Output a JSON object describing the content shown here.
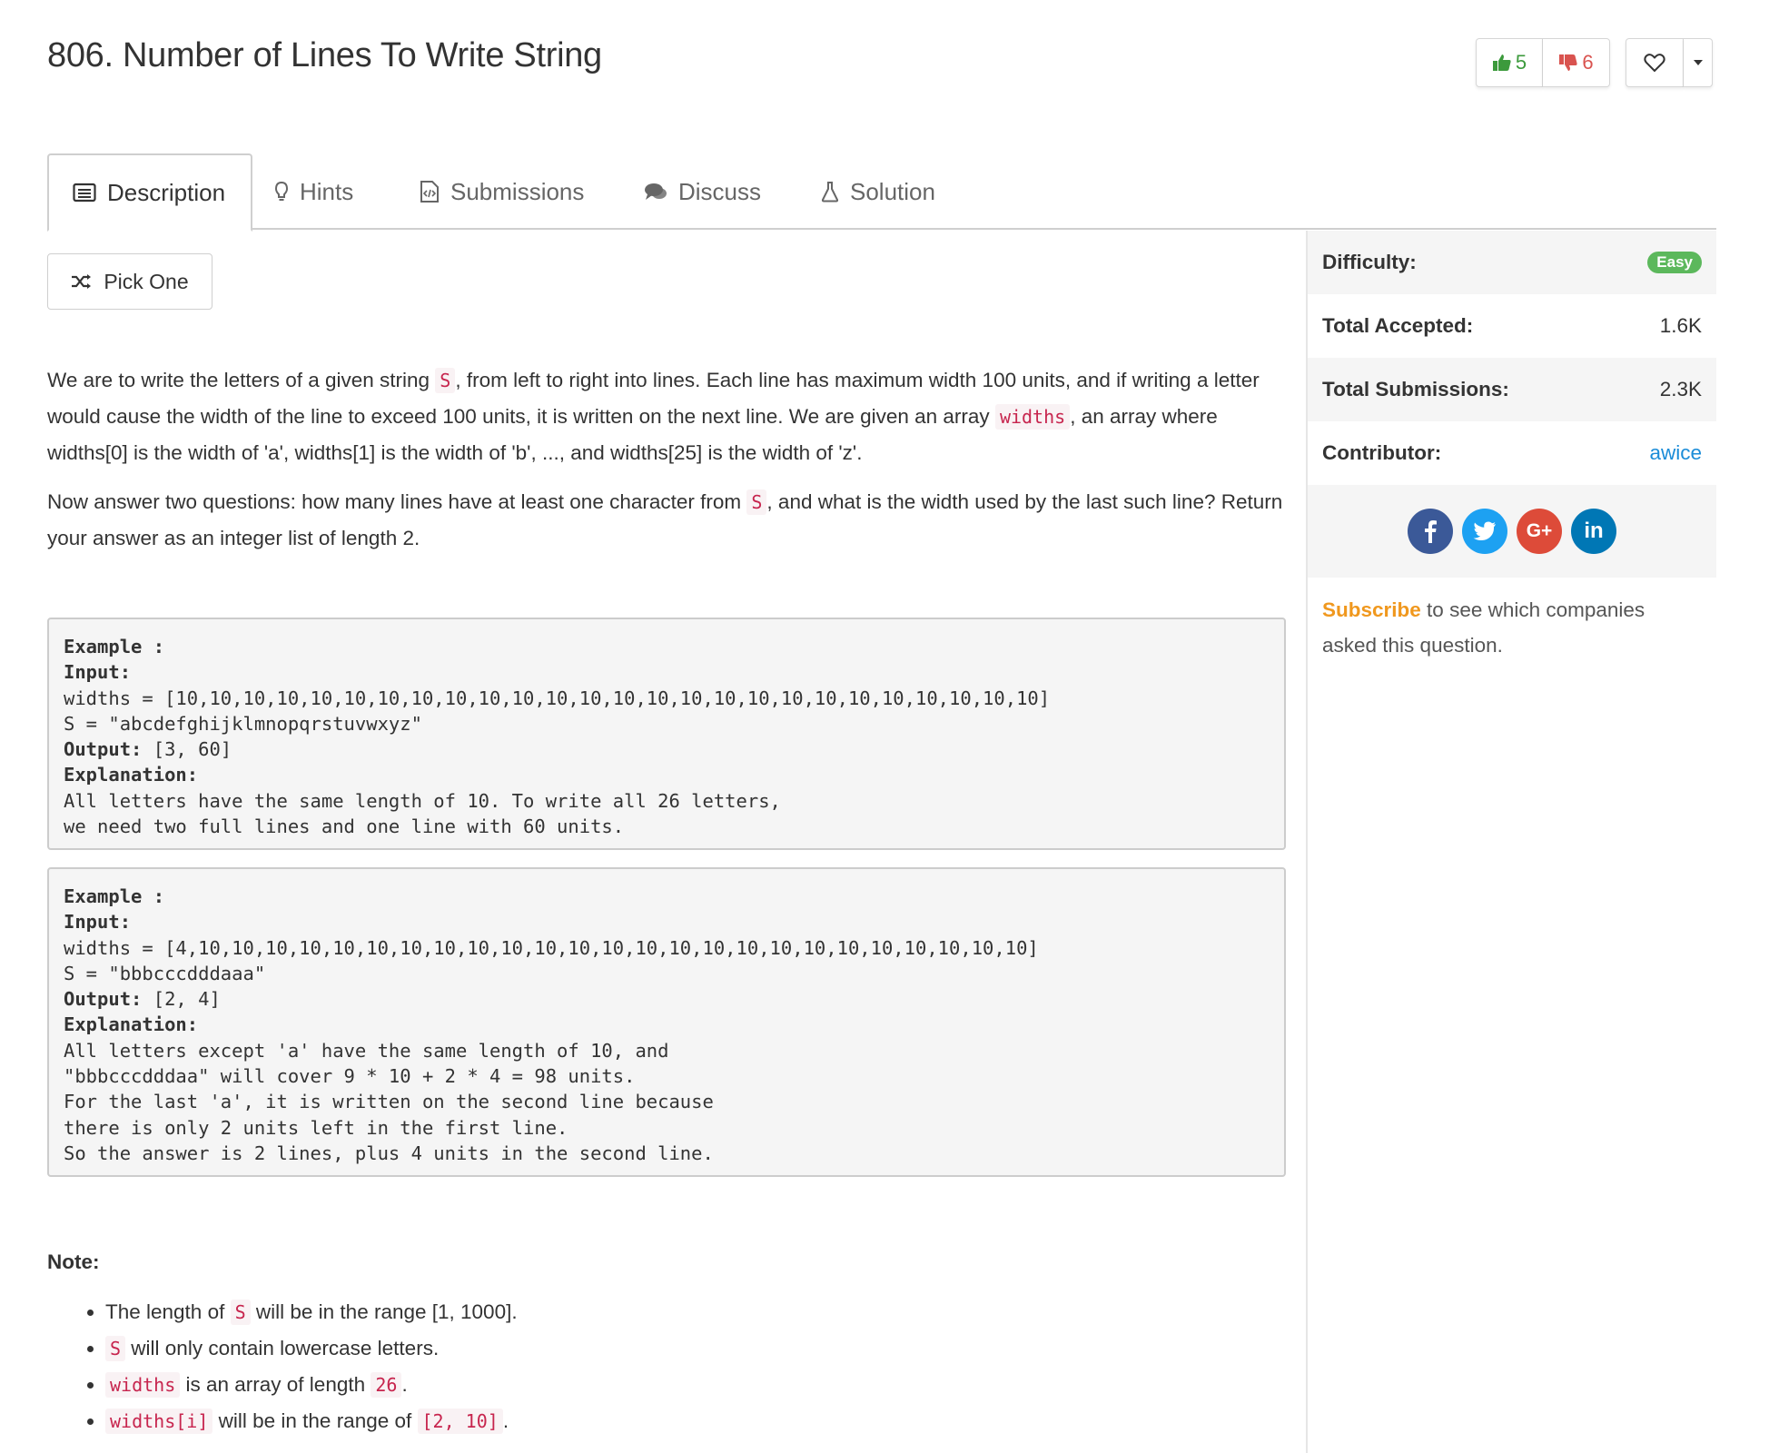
{
  "title": "806. Number of Lines To Write String",
  "votes": {
    "up": "5",
    "down": "6"
  },
  "tabs": [
    {
      "label": "Description",
      "icon": "description-icon"
    },
    {
      "label": "Hints",
      "icon": "lightbulb-icon"
    },
    {
      "label": "Submissions",
      "icon": "code-file-icon"
    },
    {
      "label": "Discuss",
      "icon": "comments-icon"
    },
    {
      "label": "Solution",
      "icon": "flask-icon"
    }
  ],
  "pick_one": "Pick One",
  "description": {
    "p1_a": "We are to write the letters of a given string ",
    "p1_code_s": "S",
    "p1_b": ", from left to right into lines. Each line has maximum width 100 units, and if writing a letter would cause the width of the line to exceed 100 units, it is written on the next line. We are given an array ",
    "p1_code_widths": "widths",
    "p1_c": ", an array where widths[0] is the width of 'a', widths[1] is the width of 'b', ..., and widths[25] is the width of 'z'.",
    "p2_a": "Now answer two questions: how many lines have at least one character from ",
    "p2_code_s": "S",
    "p2_b": ", and what is the width used by the last such line? Return your answer as an integer list of length 2."
  },
  "examples": [
    {
      "heading": "Example :",
      "input_label": "Input:",
      "widths_line": "widths = [10,10,10,10,10,10,10,10,10,10,10,10,10,10,10,10,10,10,10,10,10,10,10,10,10,10]",
      "s_line": "S = \"abcdefghijklmnopqrstuvwxyz\"",
      "output_label": "Output:",
      "output_value": " [3, 60]",
      "explanation_label": "Explanation:",
      "explanation_lines": [
        "All letters have the same length of 10. To write all 26 letters,",
        "we need two full lines and one line with 60 units."
      ]
    },
    {
      "heading": "Example :",
      "input_label": "Input:",
      "widths_line": "widths = [4,10,10,10,10,10,10,10,10,10,10,10,10,10,10,10,10,10,10,10,10,10,10,10,10,10]",
      "s_line": "S = \"bbbcccdddaaa\"",
      "output_label": "Output:",
      "output_value": " [2, 4]",
      "explanation_label": "Explanation:",
      "explanation_lines": [
        "All letters except 'a' have the same length of 10, and",
        "\"bbbcccdddaa\" will cover 9 * 10 + 2 * 4 = 98 units.",
        "For the last 'a', it is written on the second line because",
        "there is only 2 units left in the first line.",
        "So the answer is 2 lines, plus 4 units in the second line."
      ]
    }
  ],
  "note": {
    "title": "Note:",
    "items": [
      {
        "pre": "The length of ",
        "code": "S",
        "post": " will be in the range [1, 1000]."
      },
      {
        "pre": "",
        "code": "S",
        "post": " will only contain lowercase letters."
      },
      {
        "pre": "",
        "code": "widths",
        "post": " is an array of length ",
        "code2": "26",
        "post2": "."
      },
      {
        "pre": "",
        "code": "widths[i]",
        "post": " will be in the range of ",
        "code2": "[2, 10]",
        "post2": "."
      }
    ]
  },
  "sidebar": {
    "difficulty_label": "Difficulty:",
    "difficulty_value": "Easy",
    "accepted_label": "Total Accepted:",
    "accepted_value": "1.6K",
    "submissions_label": "Total Submissions:",
    "submissions_value": "2.3K",
    "contributor_label": "Contributor:",
    "contributor_value": "awice",
    "social": [
      {
        "name": "facebook-icon",
        "glyph": "f",
        "color": "#3b5998"
      },
      {
        "name": "twitter-icon",
        "glyph": "t",
        "color": "#1da1f2"
      },
      {
        "name": "google-plus-icon",
        "glyph": "G+",
        "color": "#dd4b39"
      },
      {
        "name": "linkedin-icon",
        "glyph": "in",
        "color": "#0077b5"
      }
    ],
    "subscribe_link": "Subscribe",
    "subscribe_text": " to see which companies asked this question."
  },
  "colors": {
    "easy_badge": "#5cb85c",
    "code_text": "#c7254e",
    "subscribe": "#f0981e",
    "link": "#1a8cd8",
    "upvote": "#3c9a3c",
    "downvote": "#d9534f"
  }
}
